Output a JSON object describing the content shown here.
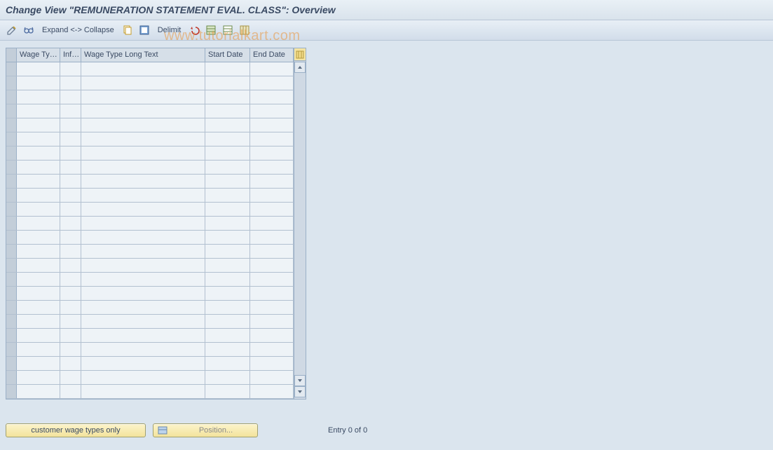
{
  "title": "Change View \"REMUNERATION STATEMENT EVAL. CLASS\": Overview",
  "toolbar": {
    "expand_collapse": "Expand <-> Collapse",
    "delimit": "Delimit"
  },
  "table": {
    "columns": [
      "Wage Ty…",
      "Inf…",
      "Wage Type Long Text",
      "Start Date",
      "End Date"
    ],
    "row_count": 24
  },
  "bottom": {
    "customer_button": "customer wage types only",
    "position_button": "Position...",
    "entry_text": "Entry 0 of 0"
  },
  "watermark": "www.tutorialkart.com"
}
